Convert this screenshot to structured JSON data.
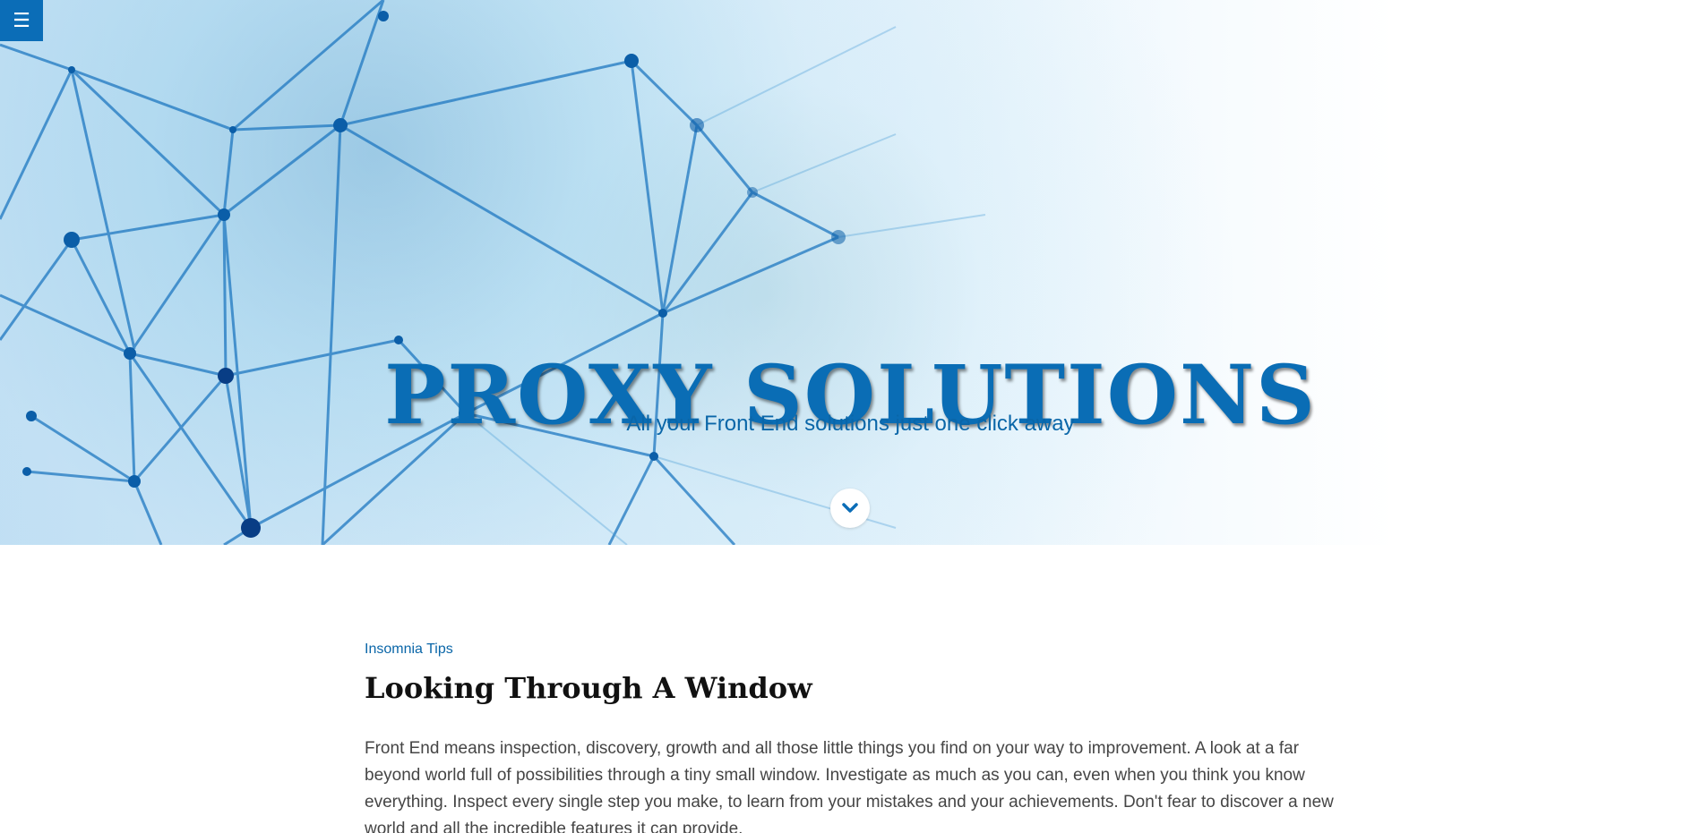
{
  "menu": {
    "icon": "hamburger-menu-icon",
    "glyph": "☰",
    "color": "#0b6db7"
  },
  "hero": {
    "title": "PROXY SOLUTIONS",
    "subtitle": "All your Front End solutions just one click away",
    "scroll_icon": "chevron-down-icon",
    "title_color": "#0a6db5",
    "subtitle_color": "#0a66a8"
  },
  "article": {
    "category": "Insomnia Tips",
    "title": "Looking Through A Window",
    "body": "Front End means inspection, discovery, growth and all those little things you find on your way to improvement. A look at a far beyond world full of possibilities through a tiny small window. Investigate as much as you can, even when you think you know everything. Inspect every single step you make, to learn from your mistakes and your achievements. Don't fear to discover a new world and all the incredible features it can provide."
  }
}
